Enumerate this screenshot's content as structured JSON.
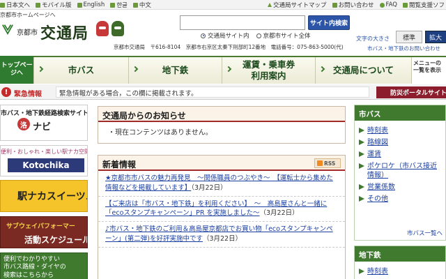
{
  "utility": {
    "left": [
      "日本文へ",
      "モバイル版",
      "English",
      "한글",
      "中文"
    ],
    "right": [
      "交通局サイトマップ",
      "お問い合わせ",
      "FAQ",
      "閲覧支援ソフ"
    ]
  },
  "header": {
    "home_link": "京都市ホームページへ",
    "city": "京都市",
    "title": "交通局",
    "address": "京都市交通局　〒616-8104　京都市右京区太秦下刑部町12番地　電話番号：075-863-5000(代)",
    "search_placeholder": "",
    "search_button": "サイト内検索",
    "radio_1": "交通局サイト内",
    "radio_2": "京都市サイト全体",
    "fontsize_label": "文字の大きさ",
    "fontsize_std": "標準",
    "fontsize_lg": "拡大",
    "subway_link": "市バス・地下鉄のお問い合わせ"
  },
  "nav": {
    "top": "トップページへ",
    "items": [
      "市バス",
      "地下鉄",
      "運賃・乗車券\n利用案内",
      "交通局について"
    ],
    "menu": "メニューの一覧を表示"
  },
  "emergency": {
    "label": "緊急情報",
    "message": "緊急情報がある場合，この欄に掲載されます。",
    "button": "防災ポータルサイト"
  },
  "banners": {
    "b1_title": "市バス・地下鉄経路検索サイト",
    "b1_logo": "洛",
    "b1_name": "ナビ",
    "b2_title": "便利・おしゃれ・楽しい駅ナカ空間",
    "b2_name": "Kotochika",
    "b3_name": "駅ナカスイーツ♪",
    "b4_line1": "サブウェイパフォーマー",
    "b4_line2": "活動スケジュール",
    "b5_text": "便利でわかりやすい\n市バス路線・ダイヤの\n検索はこちらから"
  },
  "notice": {
    "title": "交通局からのお知らせ",
    "body": "・現在コンテンツはありません。"
  },
  "news": {
    "title": "新着情報",
    "rss": "RSS",
    "items": [
      {
        "text": "★京都市市バスの魅力再発見　～関係職員のつぶやき～　【運転士から集めた情報などを掲載しています】",
        "date": "（3月22日）"
      },
      {
        "text": "【ご来店は「市バス・地下鉄」を利用ください】　～　高島屋さんと一緒に「ecoスタンプキャンペーン」PR を実施しました～",
        "date": "（3月22日）"
      },
      {
        "text": "♪市バス・地下鉄のご利用＆高島屋京都店でお買い物「ecoスタンプキャンペーン」(第二弾)を好評実施中です",
        "date": "（3月22日）"
      }
    ]
  },
  "sidebar": {
    "bus_title": "市バス",
    "bus_items": [
      "時刻表",
      "路線図",
      "運賃",
      "ポケロケ（市バス接近情報）",
      "営業係数",
      "その他"
    ],
    "bus_more": "市バス一覧へ",
    "subway_title": "地下鉄",
    "subway_items": [
      "時刻表"
    ]
  }
}
